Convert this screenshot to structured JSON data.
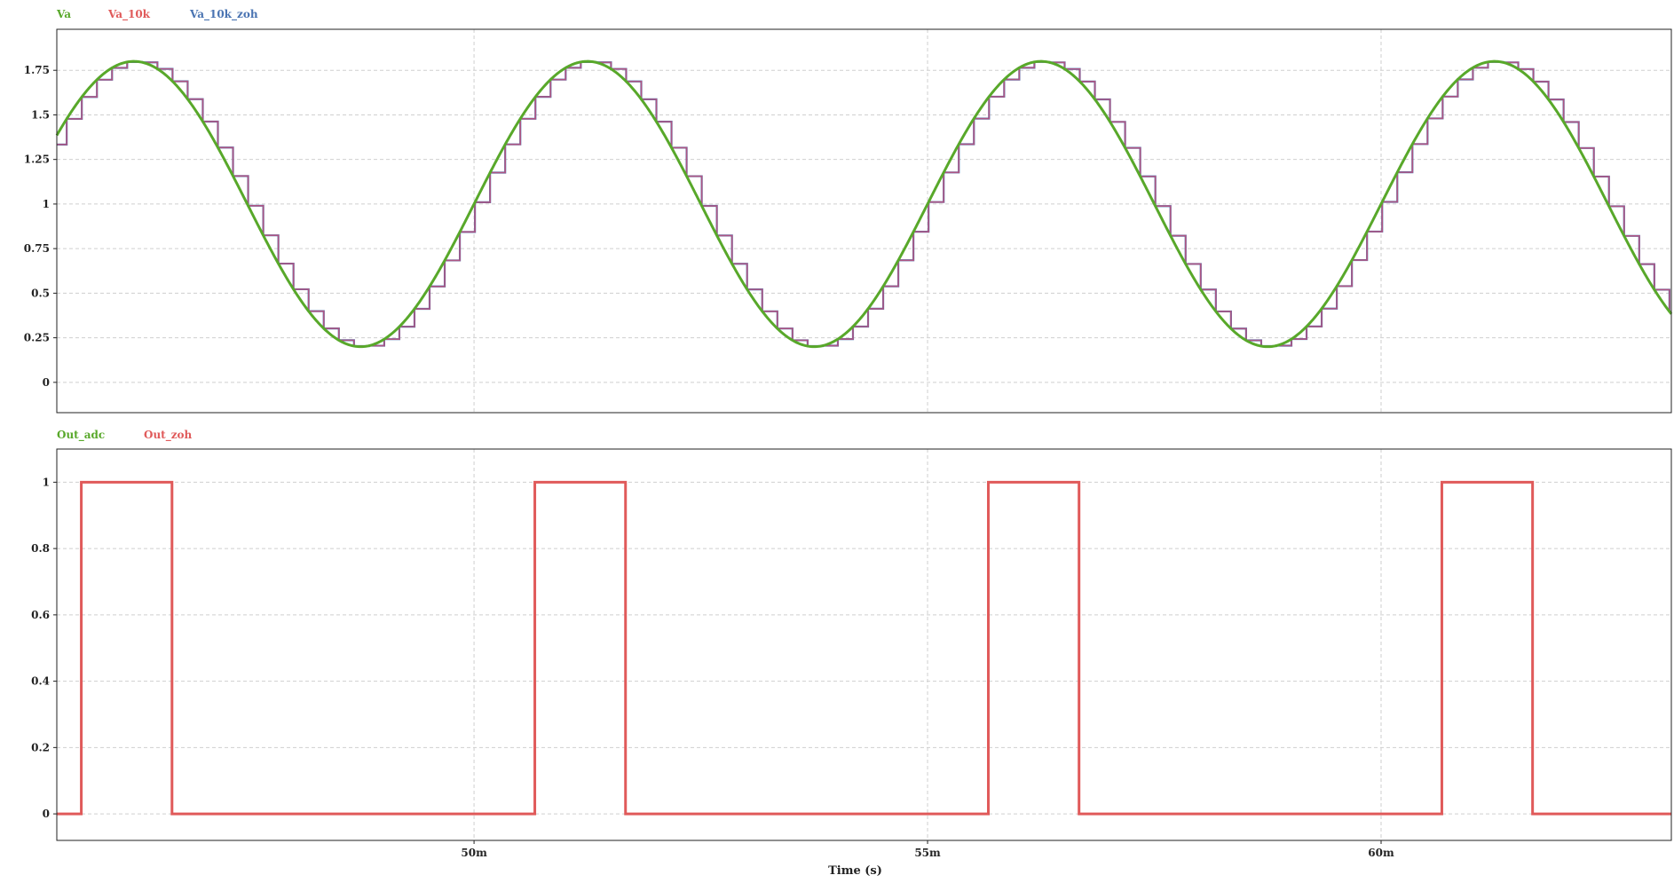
{
  "chart_data": [
    {
      "type": "line",
      "legend": [
        {
          "name": "Va",
          "color": "#58a82a"
        },
        {
          "name": "Va_10k",
          "color": "#e05a5a"
        },
        {
          "name": "Va_10k_zoh",
          "color": "#4a74b2"
        }
      ],
      "legend_placement": "top-left, above plot",
      "ylim": [
        -0.17,
        1.98
      ],
      "yticks": [
        0,
        0.25,
        0.5,
        0.75,
        1,
        1.25,
        1.5,
        1.75
      ],
      "ytick_labels": [
        "0",
        "0.25",
        "0.5",
        "0.75",
        "1",
        "1.25",
        "1.5",
        "1.75"
      ],
      "xlim_ms": [
        45.4,
        63.2
      ],
      "grid": true,
      "signal": {
        "description": "sine, 200 Hz, offset 1.0, amplitude 0.8",
        "offset": 1.0,
        "amplitude": 0.8,
        "frequency_hz": 200,
        "peaks_ms": [
          46.25,
          51.25,
          56.25,
          61.25
        ],
        "troughs_ms": [
          48.75,
          53.75,
          58.75
        ]
      },
      "series": [
        {
          "name": "Va",
          "style": "smooth sine",
          "color": "#58a82a"
        },
        {
          "name": "Va_10k",
          "style": "zero-order-hold staircase (sample-and-hold)",
          "color": "#e05a5a"
        },
        {
          "name": "Va_10k_zoh",
          "style": "zero-order-hold staircase, overlaps Va_10k (appears purple)",
          "color": "#4a74b2"
        }
      ],
      "zoh_sample_period_ms": 0.1667
    },
    {
      "type": "line",
      "legend": [
        {
          "name": "Out_adc",
          "color": "#58a82a"
        },
        {
          "name": "Out_zoh",
          "color": "#e05a5a"
        }
      ],
      "legend_placement": "top-left, above plot",
      "ylim": [
        -0.08,
        1.1
      ],
      "yticks": [
        0,
        0.2,
        0.4,
        0.6,
        0.8,
        1
      ],
      "ytick_labels": [
        "0",
        "0.2",
        "0.4",
        "0.6",
        "0.8",
        "1"
      ],
      "xlim_ms": [
        45.4,
        63.2
      ],
      "xticks_ms": [
        50,
        55,
        60
      ],
      "xtick_labels": [
        "50m",
        "55m",
        "60m"
      ],
      "xlabel": "Time (s)",
      "grid": true,
      "series": [
        {
          "name": "Out_zoh",
          "color": "#e05a5a",
          "step_points_ms": [
            [
              45.4,
              0
            ],
            [
              45.67,
              0
            ],
            [
              45.67,
              1
            ],
            [
              46.67,
              1
            ],
            [
              46.67,
              0
            ],
            [
              50.67,
              0
            ],
            [
              50.67,
              1
            ],
            [
              51.67,
              1
            ],
            [
              51.67,
              0
            ],
            [
              55.67,
              0
            ],
            [
              55.67,
              1
            ],
            [
              56.67,
              1
            ],
            [
              56.67,
              0
            ],
            [
              60.67,
              0
            ],
            [
              60.67,
              1
            ],
            [
              61.67,
              1
            ],
            [
              61.67,
              0
            ],
            [
              63.2,
              0
            ]
          ]
        }
      ]
    }
  ]
}
